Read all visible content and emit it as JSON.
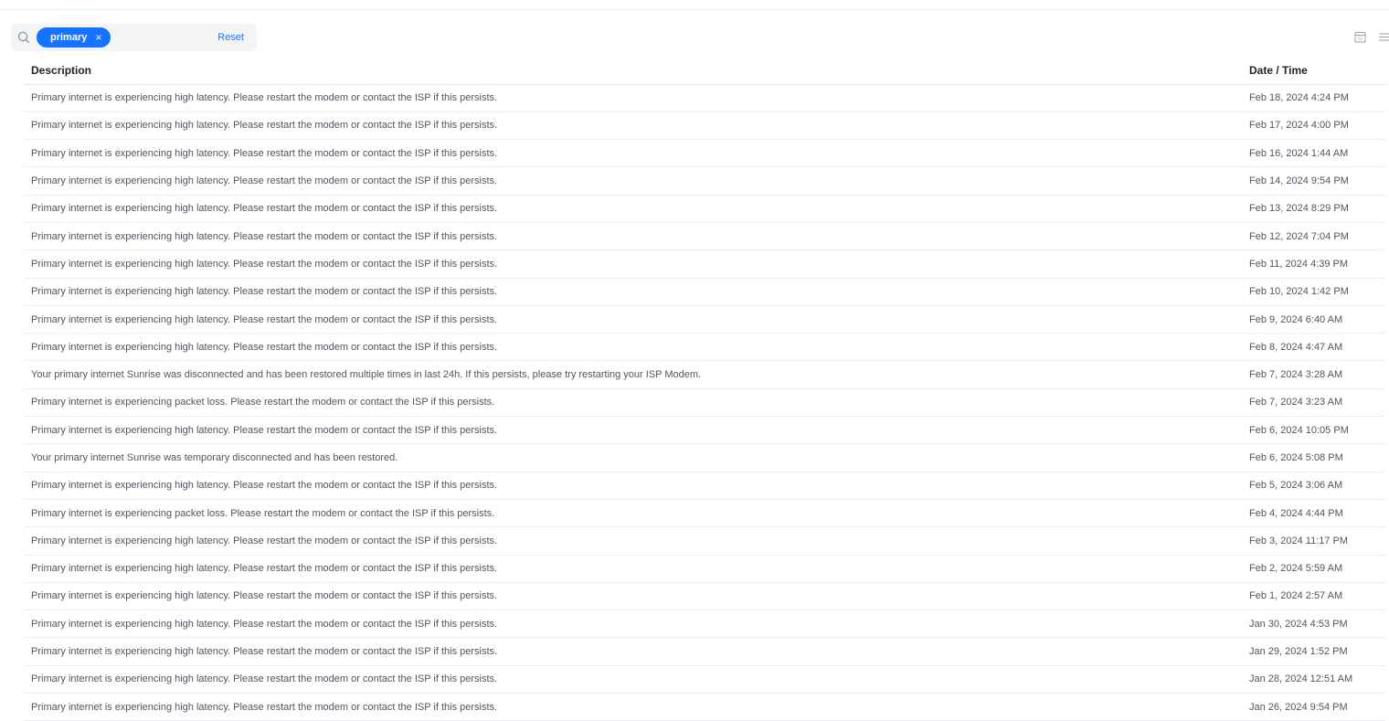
{
  "filter": {
    "chip_label": "primary",
    "chip_close": "×",
    "reset_label": "Reset"
  },
  "icons": {
    "search": "search-icon",
    "calendar": "calendar-icon",
    "menu": "menu-icon"
  },
  "colors": {
    "accent": "#1573ff",
    "text": "#50565e",
    "header_text": "#212327",
    "divider": "#eceef1"
  },
  "table": {
    "columns": [
      "Description",
      "Date / Time"
    ],
    "rows": [
      {
        "description": "Primary internet is experiencing high latency. Please restart the modem or contact the ISP if this persists.",
        "datetime": "Feb 18, 2024 4:24 PM"
      },
      {
        "description": "Primary internet is experiencing high latency. Please restart the modem or contact the ISP if this persists.",
        "datetime": "Feb 17, 2024 4:00 PM"
      },
      {
        "description": "Primary internet is experiencing high latency. Please restart the modem or contact the ISP if this persists.",
        "datetime": "Feb 16, 2024 1:44 AM"
      },
      {
        "description": "Primary internet is experiencing high latency. Please restart the modem or contact the ISP if this persists.",
        "datetime": "Feb 14, 2024 9:54 PM"
      },
      {
        "description": "Primary internet is experiencing high latency. Please restart the modem or contact the ISP if this persists.",
        "datetime": "Feb 13, 2024 8:29 PM"
      },
      {
        "description": "Primary internet is experiencing high latency. Please restart the modem or contact the ISP if this persists.",
        "datetime": "Feb 12, 2024 7:04 PM"
      },
      {
        "description": "Primary internet is experiencing high latency. Please restart the modem or contact the ISP if this persists.",
        "datetime": "Feb 11, 2024 4:39 PM"
      },
      {
        "description": "Primary internet is experiencing high latency. Please restart the modem or contact the ISP if this persists.",
        "datetime": "Feb 10, 2024 1:42 PM"
      },
      {
        "description": "Primary internet is experiencing high latency. Please restart the modem or contact the ISP if this persists.",
        "datetime": "Feb 9, 2024 6:40 AM"
      },
      {
        "description": "Primary internet is experiencing high latency. Please restart the modem or contact the ISP if this persists.",
        "datetime": "Feb 8, 2024 4:47 AM"
      },
      {
        "description": "Your primary internet Sunrise was disconnected and has been restored multiple times in last 24h. If this persists, please try restarting your ISP Modem.",
        "datetime": "Feb 7, 2024 3:28 AM"
      },
      {
        "description": "Primary internet is experiencing packet loss. Please restart the modem or contact the ISP if this persists.",
        "datetime": "Feb 7, 2024 3:23 AM"
      },
      {
        "description": "Primary internet is experiencing high latency. Please restart the modem or contact the ISP if this persists.",
        "datetime": "Feb 6, 2024 10:05 PM"
      },
      {
        "description": "Your primary internet Sunrise was temporary disconnected and has been restored.",
        "datetime": "Feb 6, 2024 5:08 PM"
      },
      {
        "description": "Primary internet is experiencing high latency. Please restart the modem or contact the ISP if this persists.",
        "datetime": "Feb 5, 2024 3:06 AM"
      },
      {
        "description": "Primary internet is experiencing packet loss. Please restart the modem or contact the ISP if this persists.",
        "datetime": "Feb 4, 2024 4:44 PM"
      },
      {
        "description": "Primary internet is experiencing high latency. Please restart the modem or contact the ISP if this persists.",
        "datetime": "Feb 3, 2024 11:17 PM"
      },
      {
        "description": "Primary internet is experiencing high latency. Please restart the modem or contact the ISP if this persists.",
        "datetime": "Feb 2, 2024 5:59 AM"
      },
      {
        "description": "Primary internet is experiencing high latency. Please restart the modem or contact the ISP if this persists.",
        "datetime": "Feb 1, 2024 2:57 AM"
      },
      {
        "description": "Primary internet is experiencing high latency. Please restart the modem or contact the ISP if this persists.",
        "datetime": "Jan 30, 2024 4:53 PM"
      },
      {
        "description": "Primary internet is experiencing high latency. Please restart the modem or contact the ISP if this persists.",
        "datetime": "Jan 29, 2024 1:52 PM"
      },
      {
        "description": "Primary internet is experiencing high latency. Please restart the modem or contact the ISP if this persists.",
        "datetime": "Jan 28, 2024 12:51 AM"
      },
      {
        "description": "Primary internet is experiencing high latency. Please restart the modem or contact the ISP if this persists.",
        "datetime": "Jan 26, 2024 9:54 PM"
      }
    ]
  }
}
